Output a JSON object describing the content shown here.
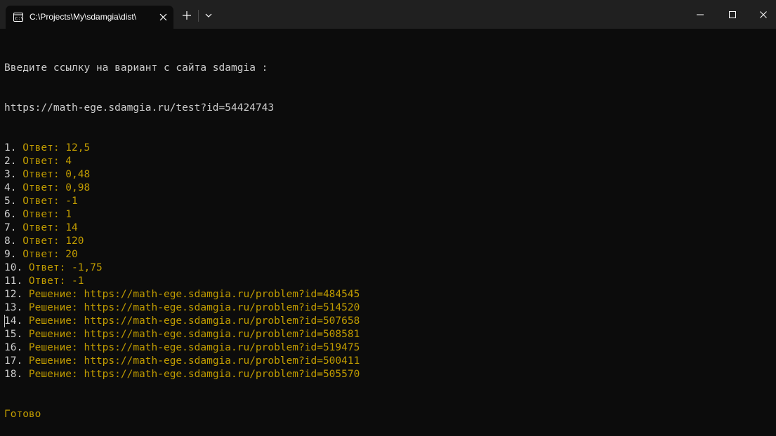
{
  "tab": {
    "title": "C:\\Projects\\My\\sdamgia\\dist\\"
  },
  "console": {
    "prompt": "Введите ссылку на вариант с сайта sdamgia :",
    "input_url": "https://math-ege.sdamgia.ru/test?id=54424743",
    "lines": [
      {
        "num": "1. ",
        "text": "Ответ: 12,5"
      },
      {
        "num": "2. ",
        "text": "Ответ: 4"
      },
      {
        "num": "3. ",
        "text": "Ответ: 0,48"
      },
      {
        "num": "4. ",
        "text": "Ответ: 0,98"
      },
      {
        "num": "5. ",
        "text": "Ответ: -1"
      },
      {
        "num": "6. ",
        "text": "Ответ: 1"
      },
      {
        "num": "7. ",
        "text": "Ответ: 14"
      },
      {
        "num": "8. ",
        "text": "Ответ: 120"
      },
      {
        "num": "9. ",
        "text": "Ответ: 20"
      },
      {
        "num": "10. ",
        "text": "Ответ: -1,75"
      },
      {
        "num": "11. ",
        "text": "Ответ: -1"
      },
      {
        "num": "12. ",
        "text": "Решение: https://math-ege.sdamgia.ru/problem?id=484545"
      },
      {
        "num": "13. ",
        "text": "Решение: https://math-ege.sdamgia.ru/problem?id=514520"
      },
      {
        "num": "14. ",
        "text": "Решение: https://math-ege.sdamgia.ru/problem?id=507658"
      },
      {
        "num": "15. ",
        "text": "Решение: https://math-ege.sdamgia.ru/problem?id=508581"
      },
      {
        "num": "16. ",
        "text": "Решение: https://math-ege.sdamgia.ru/problem?id=519475"
      },
      {
        "num": "17. ",
        "text": "Решение: https://math-ege.sdamgia.ru/problem?id=500411"
      },
      {
        "num": "18. ",
        "text": "Решение: https://math-ege.sdamgia.ru/problem?id=505570"
      }
    ],
    "done": "Готово"
  },
  "colors": {
    "background": "#0c0c0c",
    "titlebar": "#202020",
    "text_default": "#cccccc",
    "text_highlight": "#c19c00"
  },
  "icons": {
    "tab_icon": "terminal-icon",
    "tab_close": "close-icon",
    "new_tab": "plus-icon",
    "dropdown": "chevron-down-icon",
    "minimize": "minimize-icon",
    "maximize": "maximize-icon",
    "close": "close-icon"
  }
}
